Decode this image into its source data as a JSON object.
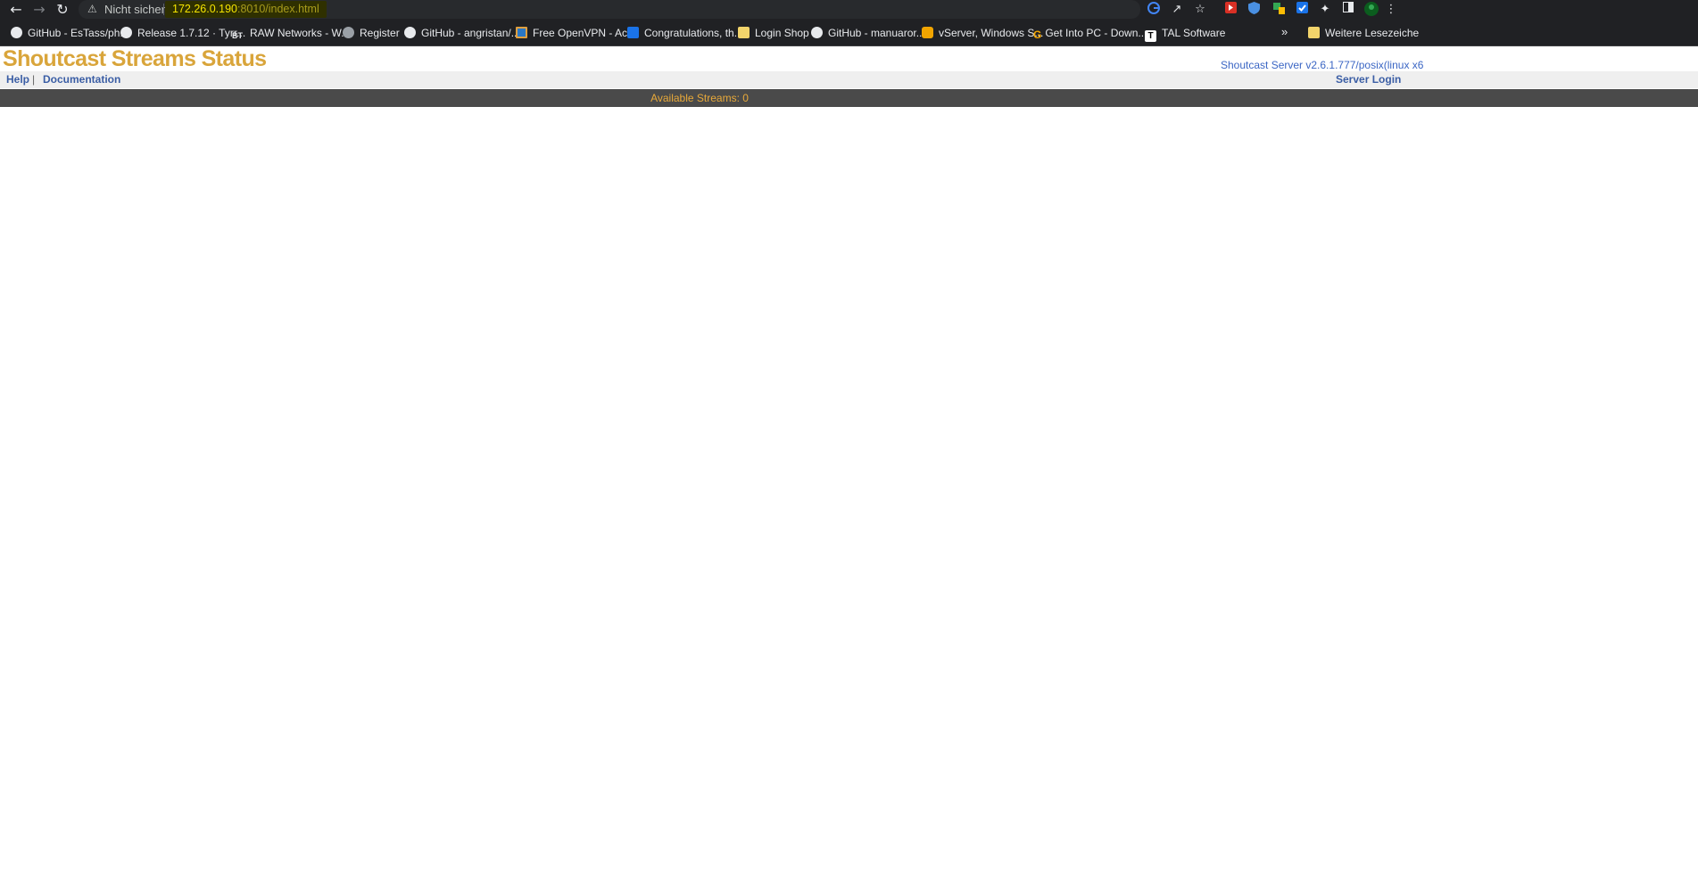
{
  "browser": {
    "security_label": "Nicht sicher",
    "url_host": "172.26.0.190",
    "url_path": ":8010/index.html",
    "bookmarks": [
      {
        "label": "GitHub - EsTass/ph...",
        "icon": "github-icon"
      },
      {
        "label": "Release 1.7.12 · Tyrr...",
        "icon": "github-icon"
      },
      {
        "label": "RAW Networks - W...",
        "icon": "bt-icon"
      },
      {
        "label": "Register",
        "icon": "globe-icon"
      },
      {
        "label": "GitHub - angristan/...",
        "icon": "github-icon"
      },
      {
        "label": "Free OpenVPN - Ac...",
        "icon": "vpn-icon"
      },
      {
        "label": "Congratulations, th...",
        "icon": "site-icon"
      },
      {
        "label": "Login Shop",
        "icon": "folder-icon"
      },
      {
        "label": "GitHub - manuaror...",
        "icon": "github-icon"
      },
      {
        "label": "vServer, Windows S...",
        "icon": "vserver-icon"
      },
      {
        "label": "Get Into PC - Down...",
        "icon": "g-icon"
      },
      {
        "label": "TAL Software",
        "icon": "t-icon"
      }
    ],
    "more_bookmarks_label": "Weitere Lesezeiche",
    "bt_text": "BT",
    "g_text": "G",
    "t_text": "T"
  },
  "page": {
    "title": "Shoutcast Streams Status",
    "server_info": "Shoutcast Server v2.6.1.777/posix(linux x6",
    "nav": {
      "help": "Help",
      "separator": "|",
      "documentation": "Documentation",
      "server_login": "Server Login"
    },
    "available_streams": "Available Streams: 0"
  },
  "colors": {
    "title": "#d9a53b",
    "link": "#3b5ea5",
    "status_bar": "#4a4a4a",
    "status_text": "#e8a93a"
  }
}
